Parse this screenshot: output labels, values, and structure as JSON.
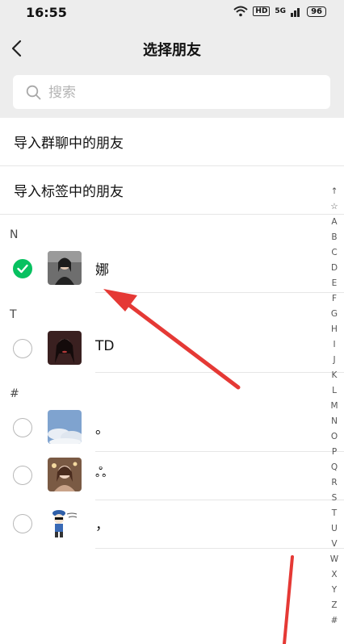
{
  "status_bar": {
    "time": "16:55",
    "hd_badge": "HD",
    "network": "5G",
    "battery": "96"
  },
  "header": {
    "title": "选择朋友"
  },
  "search": {
    "placeholder": "搜索"
  },
  "import_options": [
    {
      "label": "导入群聊中的朋友"
    },
    {
      "label": "导入标签中的朋友"
    }
  ],
  "sections": [
    {
      "letter": "N",
      "contacts": [
        {
          "name": "娜",
          "selected": true
        }
      ]
    },
    {
      "letter": "T",
      "contacts": [
        {
          "name": "TD",
          "selected": false
        }
      ]
    },
    {
      "letter": "#",
      "contacts": [
        {
          "name": "。",
          "selected": false
        },
        {
          "name": "ஃ",
          "selected": false
        },
        {
          "name": "，",
          "selected": false
        }
      ]
    }
  ],
  "index_bar": [
    "↑",
    "☆",
    "A",
    "B",
    "C",
    "D",
    "E",
    "F",
    "G",
    "H",
    "I",
    "J",
    "K",
    "L",
    "M",
    "N",
    "O",
    "P",
    "Q",
    "R",
    "S",
    "T",
    "U",
    "V",
    "W",
    "X",
    "Y",
    "Z",
    "#"
  ],
  "colors": {
    "accent": "#07c160",
    "annotation": "#e53935"
  }
}
